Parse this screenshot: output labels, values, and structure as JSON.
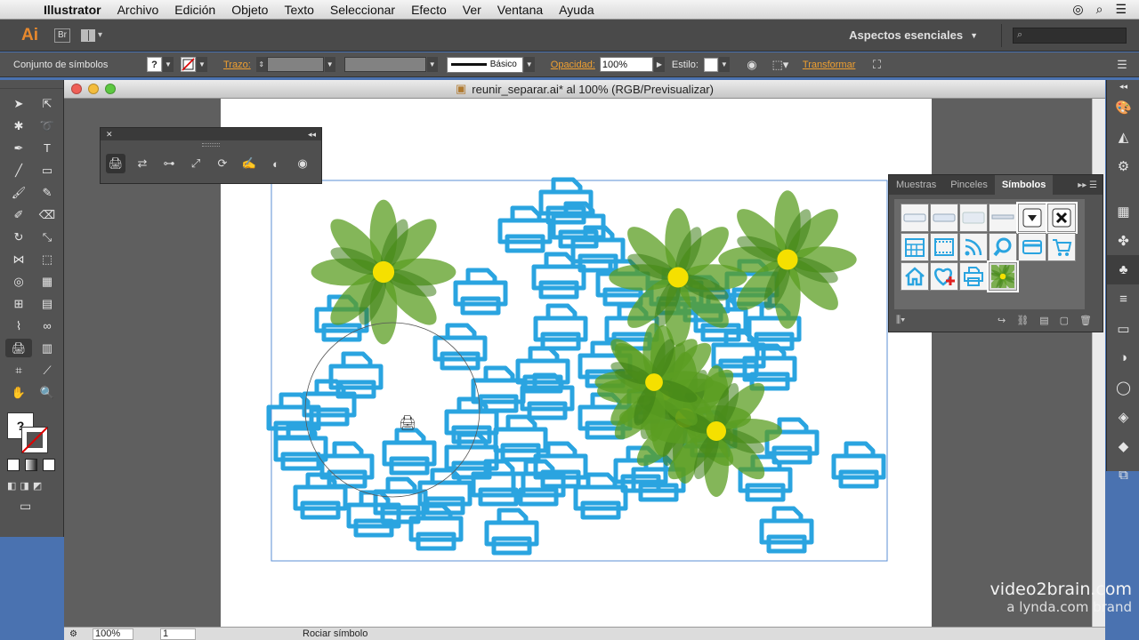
{
  "menubar": {
    "app": "Illustrator",
    "items": [
      "Archivo",
      "Edición",
      "Objeto",
      "Texto",
      "Seleccionar",
      "Efecto",
      "Ver",
      "Ventana",
      "Ayuda"
    ]
  },
  "appbar": {
    "logo": "Ai",
    "bridge": "Br",
    "workspace": "Aspectos esenciales"
  },
  "control": {
    "selection_label": "Conjunto de símbolos",
    "fill_glyph": "?",
    "stroke_label": "Trazo:",
    "brush_profile": "Básico",
    "opacity_label": "Opacidad:",
    "opacity_value": "100%",
    "style_label": "Estilo:",
    "transform_label": "Transformar"
  },
  "document": {
    "title": "reunir_separar.ai* al 100% (RGB/Previsualizar)",
    "zoom": "100%",
    "page": "1",
    "status_tool": "Rociar símbolo"
  },
  "toolbar": {
    "fill_glyph": "?"
  },
  "symbols_panel": {
    "tabs": [
      "Muestras",
      "Pinceles",
      "Símbolos"
    ],
    "active_tab": "Símbolos"
  },
  "watermark": {
    "line1": "video2brain.com",
    "line2": "a lynda.com brand"
  },
  "colors": {
    "printer_blue": "#2aa4e0",
    "flower_green": "#4f9a1f",
    "flower_center": "#f5e000",
    "accent_orange": "#f0a030"
  }
}
